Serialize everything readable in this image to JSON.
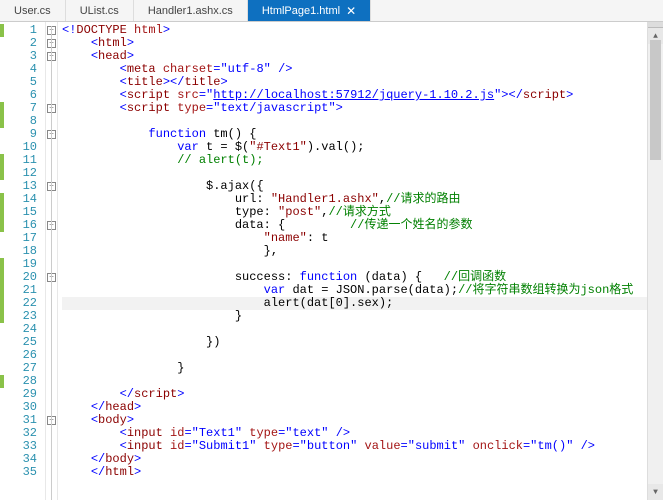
{
  "tabs": [
    {
      "label": "User.cs",
      "active": false
    },
    {
      "label": "UList.cs",
      "active": false
    },
    {
      "label": "Handler1.ashx.cs",
      "active": false
    },
    {
      "label": "HtmlPage1.html",
      "active": true,
      "close": "✕"
    }
  ],
  "outline_minus": "−",
  "lines": {
    "l1": {
      "num": "1",
      "mark": true,
      "box": true,
      "tokens": [
        [
          "<!",
          "t-blue"
        ],
        [
          "DOCTYPE",
          "t-brown"
        ],
        [
          " ",
          "t-black"
        ],
        [
          "html",
          "t-red"
        ],
        [
          ">",
          "t-blue"
        ]
      ]
    },
    "l2": {
      "num": "2",
      "mark": false,
      "box": true,
      "indent": 1,
      "tokens": [
        [
          "<",
          "t-blue"
        ],
        [
          "html",
          "t-brown"
        ],
        [
          ">",
          "t-blue"
        ]
      ]
    },
    "l3": {
      "num": "3",
      "mark": false,
      "box": true,
      "indent": 1,
      "tokens": [
        [
          "<",
          "t-blue"
        ],
        [
          "head",
          "t-brown"
        ],
        [
          ">",
          "t-blue"
        ]
      ]
    },
    "l4": {
      "num": "4",
      "mark": false,
      "box": false,
      "indent": 2,
      "tokens": [
        [
          "<",
          "t-blue"
        ],
        [
          "meta",
          "t-brown"
        ],
        [
          " ",
          "t-black"
        ],
        [
          "charset",
          "t-red"
        ],
        [
          "=\"",
          "t-blue"
        ],
        [
          "utf-8",
          "t-blue"
        ],
        [
          "\" />",
          "t-blue"
        ]
      ]
    },
    "l5": {
      "num": "5",
      "mark": false,
      "box": false,
      "indent": 2,
      "tokens": [
        [
          "<",
          "t-blue"
        ],
        [
          "title",
          "t-brown"
        ],
        [
          "></",
          "t-blue"
        ],
        [
          "title",
          "t-brown"
        ],
        [
          ">",
          "t-blue"
        ]
      ]
    },
    "l6": {
      "num": "6",
      "mark": false,
      "box": false,
      "indent": 2,
      "tokens": [
        [
          "<",
          "t-blue"
        ],
        [
          "script",
          "t-brown"
        ],
        [
          " ",
          "t-black"
        ],
        [
          "src",
          "t-red"
        ],
        [
          "=\"",
          "t-blue"
        ],
        [
          "http://localhost:57912/jquery-1.10.2.js",
          "t-url"
        ],
        [
          "\"></",
          "t-blue"
        ],
        [
          "script",
          "t-brown"
        ],
        [
          ">",
          "t-blue"
        ]
      ]
    },
    "l7": {
      "num": "7",
      "mark": true,
      "box": true,
      "indent": 2,
      "tokens": [
        [
          "<",
          "t-blue"
        ],
        [
          "script",
          "t-brown"
        ],
        [
          " ",
          "t-black"
        ],
        [
          "type",
          "t-red"
        ],
        [
          "=\"",
          "t-blue"
        ],
        [
          "text/javascript",
          "t-blue"
        ],
        [
          "\">",
          "t-blue"
        ]
      ]
    },
    "l8": {
      "num": "8",
      "mark": true,
      "box": false,
      "tokens": [
        [
          "",
          "t-black"
        ]
      ]
    },
    "l9": {
      "num": "9",
      "mark": false,
      "box": true,
      "indent": 3,
      "tokens": [
        [
          "function",
          "t-blue"
        ],
        [
          " tm() {",
          "t-black"
        ]
      ]
    },
    "l10": {
      "num": "10",
      "mark": false,
      "box": false,
      "indent": 4,
      "tokens": [
        [
          "var",
          "t-blue"
        ],
        [
          " t = $(",
          "t-black"
        ],
        [
          "\"#Text1\"",
          "t-brown"
        ],
        [
          ").val();",
          "t-black"
        ]
      ]
    },
    "l11": {
      "num": "11",
      "mark": true,
      "box": false,
      "indent": 4,
      "tokens": [
        [
          "// alert(t);",
          "t-green"
        ]
      ]
    },
    "l12": {
      "num": "12",
      "mark": true,
      "box": false,
      "tokens": [
        [
          "",
          "t-black"
        ]
      ]
    },
    "l13": {
      "num": "13",
      "mark": false,
      "box": true,
      "indent": 5,
      "tokens": [
        [
          "$.ajax({",
          "t-black"
        ]
      ]
    },
    "l14": {
      "num": "14",
      "mark": true,
      "box": false,
      "indent": 6,
      "tokens": [
        [
          "url: ",
          "t-black"
        ],
        [
          "\"Handler1.ashx\"",
          "t-brown"
        ],
        [
          ",",
          "t-black"
        ],
        [
          "//请求的路由",
          "t-green"
        ]
      ]
    },
    "l15": {
      "num": "15",
      "mark": true,
      "box": false,
      "indent": 6,
      "tokens": [
        [
          "type: ",
          "t-black"
        ],
        [
          "\"post\"",
          "t-brown"
        ],
        [
          ",",
          "t-black"
        ],
        [
          "//请求方式",
          "t-green"
        ]
      ]
    },
    "l16": {
      "num": "16",
      "mark": true,
      "box": true,
      "indent": 6,
      "tokens": [
        [
          "data: {         ",
          "t-black"
        ],
        [
          "//传递一个姓名的参数",
          "t-green"
        ]
      ]
    },
    "l17": {
      "num": "17",
      "mark": false,
      "box": false,
      "indent": 7,
      "tokens": [
        [
          "\"name\"",
          "t-brown"
        ],
        [
          ": t",
          "t-black"
        ]
      ]
    },
    "l18": {
      "num": "18",
      "mark": false,
      "box": false,
      "indent": 7,
      "tokens": [
        [
          "},",
          "t-black"
        ]
      ]
    },
    "l19": {
      "num": "19",
      "mark": true,
      "box": false,
      "tokens": [
        [
          "",
          "t-black"
        ]
      ]
    },
    "l20": {
      "num": "20",
      "mark": true,
      "box": true,
      "indent": 6,
      "tokens": [
        [
          "success: ",
          "t-black"
        ],
        [
          "function",
          "t-blue"
        ],
        [
          " (data) {   ",
          "t-black"
        ],
        [
          "//回调函数",
          "t-green"
        ]
      ]
    },
    "l21": {
      "num": "21",
      "mark": true,
      "box": false,
      "indent": 7,
      "tokens": [
        [
          "var",
          "t-blue"
        ],
        [
          " dat = JSON.parse(data);",
          "t-black"
        ],
        [
          "//将字符串数组转换为json格式",
          "t-green"
        ]
      ]
    },
    "l22": {
      "num": "22",
      "mark": true,
      "box": false,
      "indent": 7,
      "current": true,
      "tokens": [
        [
          "alert(dat[0].sex);",
          "t-black"
        ]
      ]
    },
    "l23": {
      "num": "23",
      "mark": true,
      "box": false,
      "indent": 6,
      "tokens": [
        [
          "}",
          "t-black"
        ]
      ]
    },
    "l24": {
      "num": "24",
      "mark": false,
      "box": false,
      "tokens": [
        [
          "",
          "t-black"
        ]
      ]
    },
    "l25": {
      "num": "25",
      "mark": false,
      "box": false,
      "indent": 5,
      "tokens": [
        [
          "})",
          "t-black"
        ]
      ]
    },
    "l26": {
      "num": "26",
      "mark": false,
      "box": false,
      "tokens": [
        [
          "",
          "t-black"
        ]
      ]
    },
    "l27": {
      "num": "27",
      "mark": false,
      "box": false,
      "indent": 4,
      "tokens": [
        [
          "}",
          "t-black"
        ]
      ]
    },
    "l28": {
      "num": "28",
      "mark": true,
      "box": false,
      "tokens": [
        [
          "",
          "t-black"
        ]
      ]
    },
    "l29": {
      "num": "29",
      "mark": false,
      "box": false,
      "indent": 2,
      "tokens": [
        [
          "</",
          "t-blue"
        ],
        [
          "script",
          "t-brown"
        ],
        [
          ">",
          "t-blue"
        ]
      ]
    },
    "l30": {
      "num": "30",
      "mark": false,
      "box": false,
      "indent": 1,
      "tokens": [
        [
          "</",
          "t-blue"
        ],
        [
          "head",
          "t-brown"
        ],
        [
          ">",
          "t-blue"
        ]
      ]
    },
    "l31": {
      "num": "31",
      "mark": false,
      "box": true,
      "indent": 1,
      "tokens": [
        [
          "<",
          "t-blue"
        ],
        [
          "body",
          "t-brown"
        ],
        [
          ">",
          "t-blue"
        ]
      ]
    },
    "l32": {
      "num": "32",
      "mark": false,
      "box": false,
      "indent": 2,
      "tokens": [
        [
          "<",
          "t-blue"
        ],
        [
          "input",
          "t-brown"
        ],
        [
          " ",
          "t-black"
        ],
        [
          "id",
          "t-red"
        ],
        [
          "=\"",
          "t-blue"
        ],
        [
          "Text1",
          "t-blue"
        ],
        [
          "\" ",
          "t-blue"
        ],
        [
          "type",
          "t-red"
        ],
        [
          "=\"",
          "t-blue"
        ],
        [
          "text",
          "t-blue"
        ],
        [
          "\" />",
          "t-blue"
        ]
      ]
    },
    "l33": {
      "num": "33",
      "mark": false,
      "box": false,
      "indent": 2,
      "tokens": [
        [
          "<",
          "t-blue"
        ],
        [
          "input",
          "t-brown"
        ],
        [
          " ",
          "t-black"
        ],
        [
          "id",
          "t-red"
        ],
        [
          "=\"",
          "t-blue"
        ],
        [
          "Submit1",
          "t-blue"
        ],
        [
          "\" ",
          "t-blue"
        ],
        [
          "type",
          "t-red"
        ],
        [
          "=\"",
          "t-blue"
        ],
        [
          "button",
          "t-blue"
        ],
        [
          "\" ",
          "t-blue"
        ],
        [
          "value",
          "t-red"
        ],
        [
          "=\"",
          "t-blue"
        ],
        [
          "submit",
          "t-blue"
        ],
        [
          "\" ",
          "t-blue"
        ],
        [
          "onclick",
          "t-red"
        ],
        [
          "=\"",
          "t-blue"
        ],
        [
          "tm()",
          "t-blue"
        ],
        [
          "\" />",
          "t-blue"
        ]
      ]
    },
    "l34": {
      "num": "34",
      "mark": false,
      "box": false,
      "indent": 1,
      "tokens": [
        [
          "</",
          "t-blue"
        ],
        [
          "body",
          "t-brown"
        ],
        [
          ">",
          "t-blue"
        ]
      ]
    },
    "l35": {
      "num": "35",
      "mark": false,
      "box": false,
      "indent": 1,
      "tokens": [
        [
          "</",
          "t-blue"
        ],
        [
          "html",
          "t-brown"
        ],
        [
          ">",
          "t-blue"
        ]
      ]
    }
  },
  "line_order": [
    "l1",
    "l2",
    "l3",
    "l4",
    "l5",
    "l6",
    "l7",
    "l8",
    "l9",
    "l10",
    "l11",
    "l12",
    "l13",
    "l14",
    "l15",
    "l16",
    "l17",
    "l18",
    "l19",
    "l20",
    "l21",
    "l22",
    "l23",
    "l24",
    "l25",
    "l26",
    "l27",
    "l28",
    "l29",
    "l30",
    "l31",
    "l32",
    "l33",
    "l34",
    "l35"
  ]
}
